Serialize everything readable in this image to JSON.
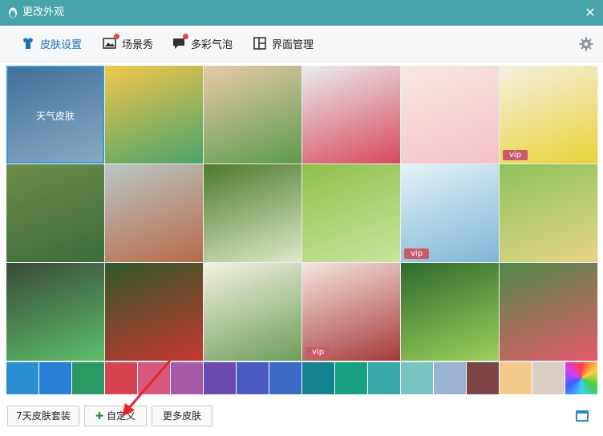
{
  "window": {
    "title": "更改外观"
  },
  "tabs": [
    {
      "label": "皮肤设置",
      "active": true,
      "icon": "shirt-icon"
    },
    {
      "label": "场景秀",
      "active": false,
      "icon": "picture-icon",
      "badge": true
    },
    {
      "label": "多彩气泡",
      "active": false,
      "icon": "bubble-icon",
      "badge": true
    },
    {
      "label": "界面管理",
      "active": false,
      "icon": "layout-icon"
    }
  ],
  "skins": [
    {
      "label": "天气皮肤",
      "vip": "",
      "colors": [
        "#3f6f9a",
        "#8aa9c4"
      ]
    },
    {
      "label": "",
      "vip": "",
      "colors": [
        "#f2c64a",
        "#4aa36b"
      ]
    },
    {
      "label": "",
      "vip": "",
      "colors": [
        "#e7c9a9",
        "#5c9b4a"
      ]
    },
    {
      "label": "",
      "vip": "",
      "colors": [
        "#e8eef0",
        "#d8485c"
      ]
    },
    {
      "label": "",
      "vip": "",
      "colors": [
        "#f6e8e0",
        "#f4c2c9"
      ]
    },
    {
      "label": "",
      "vip": "vip",
      "colors": [
        "#f4efe0",
        "#e9d438"
      ]
    },
    {
      "label": "",
      "vip": "",
      "colors": [
        "#6e8c48",
        "#3c6b3d"
      ]
    },
    {
      "label": "",
      "vip": "",
      "colors": [
        "#b8c7c4",
        "#b86a4a"
      ]
    },
    {
      "label": "",
      "vip": "",
      "colors": [
        "#4d7a2a",
        "#dde9c9"
      ]
    },
    {
      "label": "",
      "vip": "",
      "colors": [
        "#8fc04a",
        "#c9e59e"
      ]
    },
    {
      "label": "",
      "vip": "vip",
      "colors": [
        "#e4f2f4",
        "#7fb5d8"
      ]
    },
    {
      "label": "",
      "vip": "",
      "colors": [
        "#8dc35a",
        "#e6d486"
      ]
    },
    {
      "label": "",
      "vip": "",
      "colors": [
        "#3b4a3a",
        "#5bbf6a"
      ]
    },
    {
      "label": "",
      "vip": "",
      "colors": [
        "#2e5a2c",
        "#c8362e"
      ]
    },
    {
      "label": "",
      "vip": "",
      "colors": [
        "#f4f1e0",
        "#6c9d5a"
      ]
    },
    {
      "label": "",
      "vip": "vip",
      "colors": [
        "#f6e5de",
        "#a53a3a"
      ]
    },
    {
      "label": "",
      "vip": "",
      "colors": [
        "#2f6a2c",
        "#9dd05a"
      ]
    },
    {
      "label": "",
      "vip": "",
      "colors": [
        "#4e8a4a",
        "#e55a6a"
      ]
    }
  ],
  "swatches": [
    "#2a8fd0",
    "#2a7fd6",
    "#2a9a62",
    "#d64451",
    "#d6587e",
    "#a85aa8",
    "#6a4ab0",
    "#4a5ac0",
    "#3a6ac4",
    "#14838f",
    "#19a07e",
    "#39a8a8",
    "#78c4c0",
    "#9ab4d0",
    "#7d4545",
    "#f4c98a",
    "#d9cfc3",
    "#5fc6d9"
  ],
  "buttons": {
    "suit": "7天皮肤套装",
    "custom": "自定义",
    "more": "更多皮肤"
  },
  "icons": {
    "titleLogo": "qq-penguin-icon",
    "close": "close-icon",
    "settings": "gear-icon",
    "window": "window-icon"
  }
}
